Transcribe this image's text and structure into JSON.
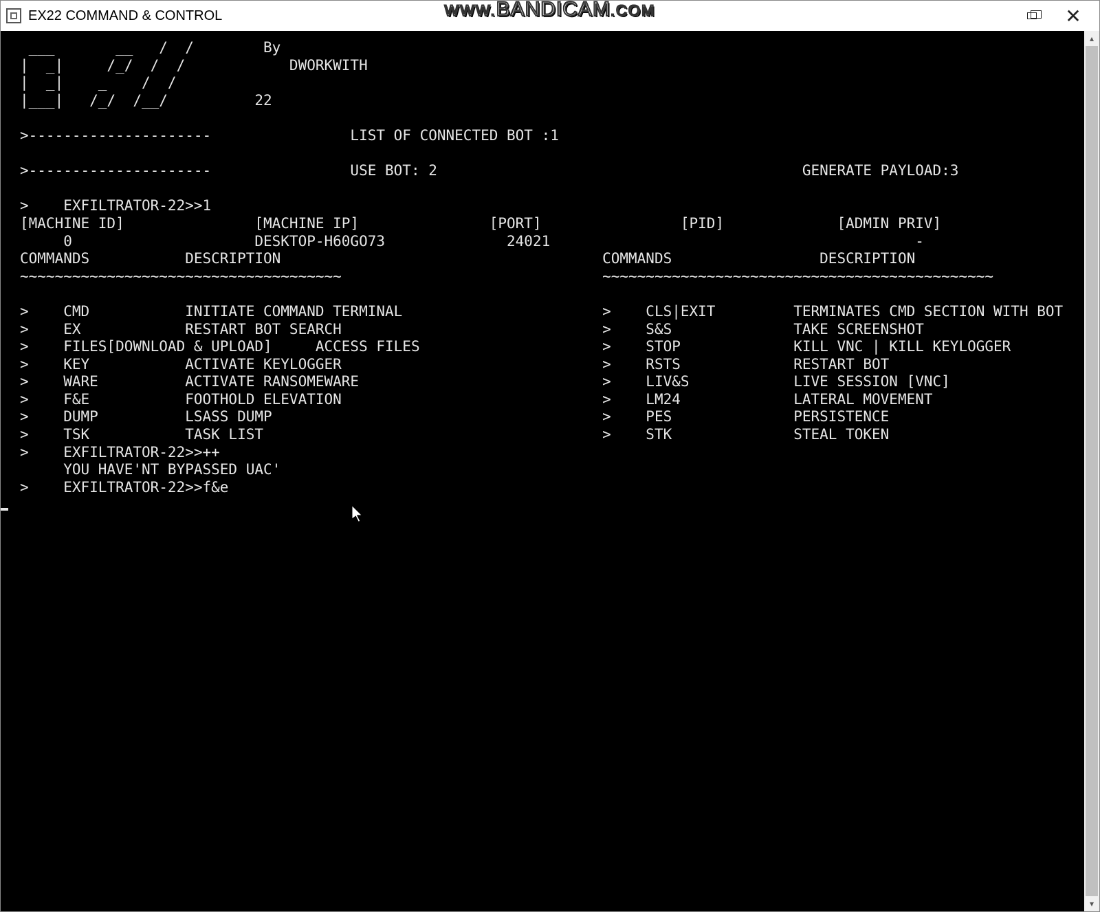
{
  "window": {
    "title": "EX22 COMMAND & CONTROL",
    "watermark_prefix": "www.",
    "watermark_main": "BANDICAM",
    "watermark_suffix": ".com"
  },
  "ascii_logo": {
    "line1": " ___       __   /  /        By",
    "line2": "|  _|     /_/  /  /            DWORKWITH",
    "line3": "|  _|    _    /  /",
    "line4": "|___|   /_/  /__/          22"
  },
  "menu": {
    "connected_bots_label": "LIST OF CONNECTED BOT :1",
    "use_bot_label": "USE BOT: 2",
    "generate_payload_label": "GENERATE PAYLOAD:3",
    "dashes": ">---------------------"
  },
  "session": {
    "prompt1_prefix": ">    EXFILTRATOR-22>>",
    "prompt1_value": "1",
    "headers": {
      "machine_id": "[MACHINE ID]",
      "machine_ip": "[MACHINE IP]",
      "port": "[PORT]",
      "pid": "[PID]",
      "admin_priv": "[ADMIN PRIV]"
    },
    "row": {
      "machine_id": "0",
      "machine_ip": "DESKTOP-H60GO73",
      "port": "24021",
      "pid": "",
      "admin_priv": "-"
    },
    "col_hdr_cmd": "COMMANDS",
    "col_hdr_desc": "DESCRIPTION",
    "tilde_left": "~~~~~~~~~~~~~~~~~~~~~~~~~~~~~~~~~~~~~",
    "tilde_right": "~~~~~~~~~~~~~~~~~~~~~~~~~~~~~~~~~~~~~~~~~~~~~"
  },
  "commands_left": [
    {
      "cmd": "CMD",
      "desc": "INITIATE COMMAND TERMINAL"
    },
    {
      "cmd": "EX",
      "desc": "RESTART BOT SEARCH"
    },
    {
      "cmd": "FILES[DOWNLOAD & UPLOAD]",
      "desc": "ACCESS FILES"
    },
    {
      "cmd": "KEY",
      "desc": "ACTIVATE KEYLOGGER"
    },
    {
      "cmd": "WARE",
      "desc": "ACTIVATE RANSOMEWARE"
    },
    {
      "cmd": "F&E",
      "desc": "FOOTHOLD ELEVATION"
    },
    {
      "cmd": "DUMP",
      "desc": "LSASS DUMP"
    },
    {
      "cmd": "TSK",
      "desc": "TASK LIST"
    }
  ],
  "commands_right": [
    {
      "cmd": "CLS|EXIT",
      "desc": "TERMINATES CMD SECTION WITH BOT"
    },
    {
      "cmd": "S&S",
      "desc": "TAKE SCREENSHOT"
    },
    {
      "cmd": "STOP",
      "desc": "KILL VNC | KILL KEYLOGGER"
    },
    {
      "cmd": "RSTS",
      "desc": "RESTART BOT"
    },
    {
      "cmd": "LIV&S",
      "desc": "LIVE SESSION [VNC]"
    },
    {
      "cmd": "LM24",
      "desc": "LATERAL MOVEMENT"
    },
    {
      "cmd": "PES",
      "desc": "PERSISTENCE"
    },
    {
      "cmd": "STK",
      "desc": "STEAL TOKEN"
    }
  ],
  "tail": {
    "prompt2_prefix": ">    EXFILTRATOR-22>>",
    "prompt2_value": "++",
    "uac_msg": "     YOU HAVE'NT BYPASSED UAC'",
    "prompt3_prefix": ">    EXFILTRATOR-22>>",
    "prompt3_value": "f&e"
  }
}
